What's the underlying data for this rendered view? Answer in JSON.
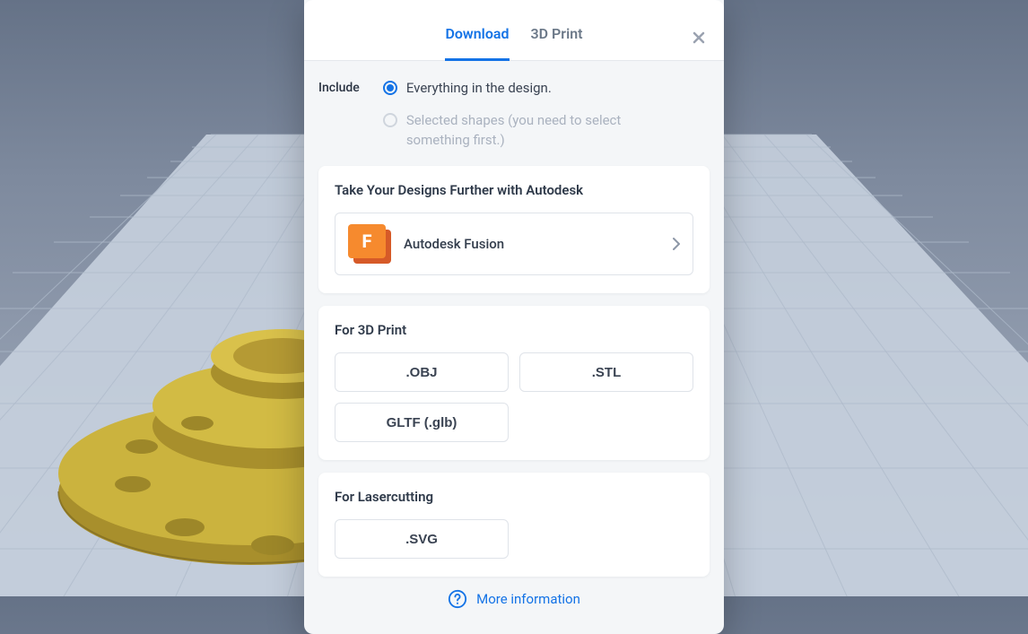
{
  "dialog": {
    "tabs": {
      "download": "Download",
      "print": "3D Print",
      "active": "download"
    },
    "include": {
      "label": "Include",
      "everything": "Everything in the design.",
      "selected": "Selected shapes (you need to select something first.)",
      "value": "everything"
    },
    "autodesk": {
      "heading": "Take Your Designs Further with Autodesk",
      "fusion_label": "Autodesk Fusion",
      "fusion_badge": "F"
    },
    "print3d": {
      "heading": "For 3D Print",
      "formats": {
        "obj": ".OBJ",
        "stl": ".STL",
        "gltf": "GLTF (.glb)"
      }
    },
    "laser": {
      "heading": "For Lasercutting",
      "formats": {
        "svg": ".SVG"
      }
    },
    "more_info": "More information"
  }
}
